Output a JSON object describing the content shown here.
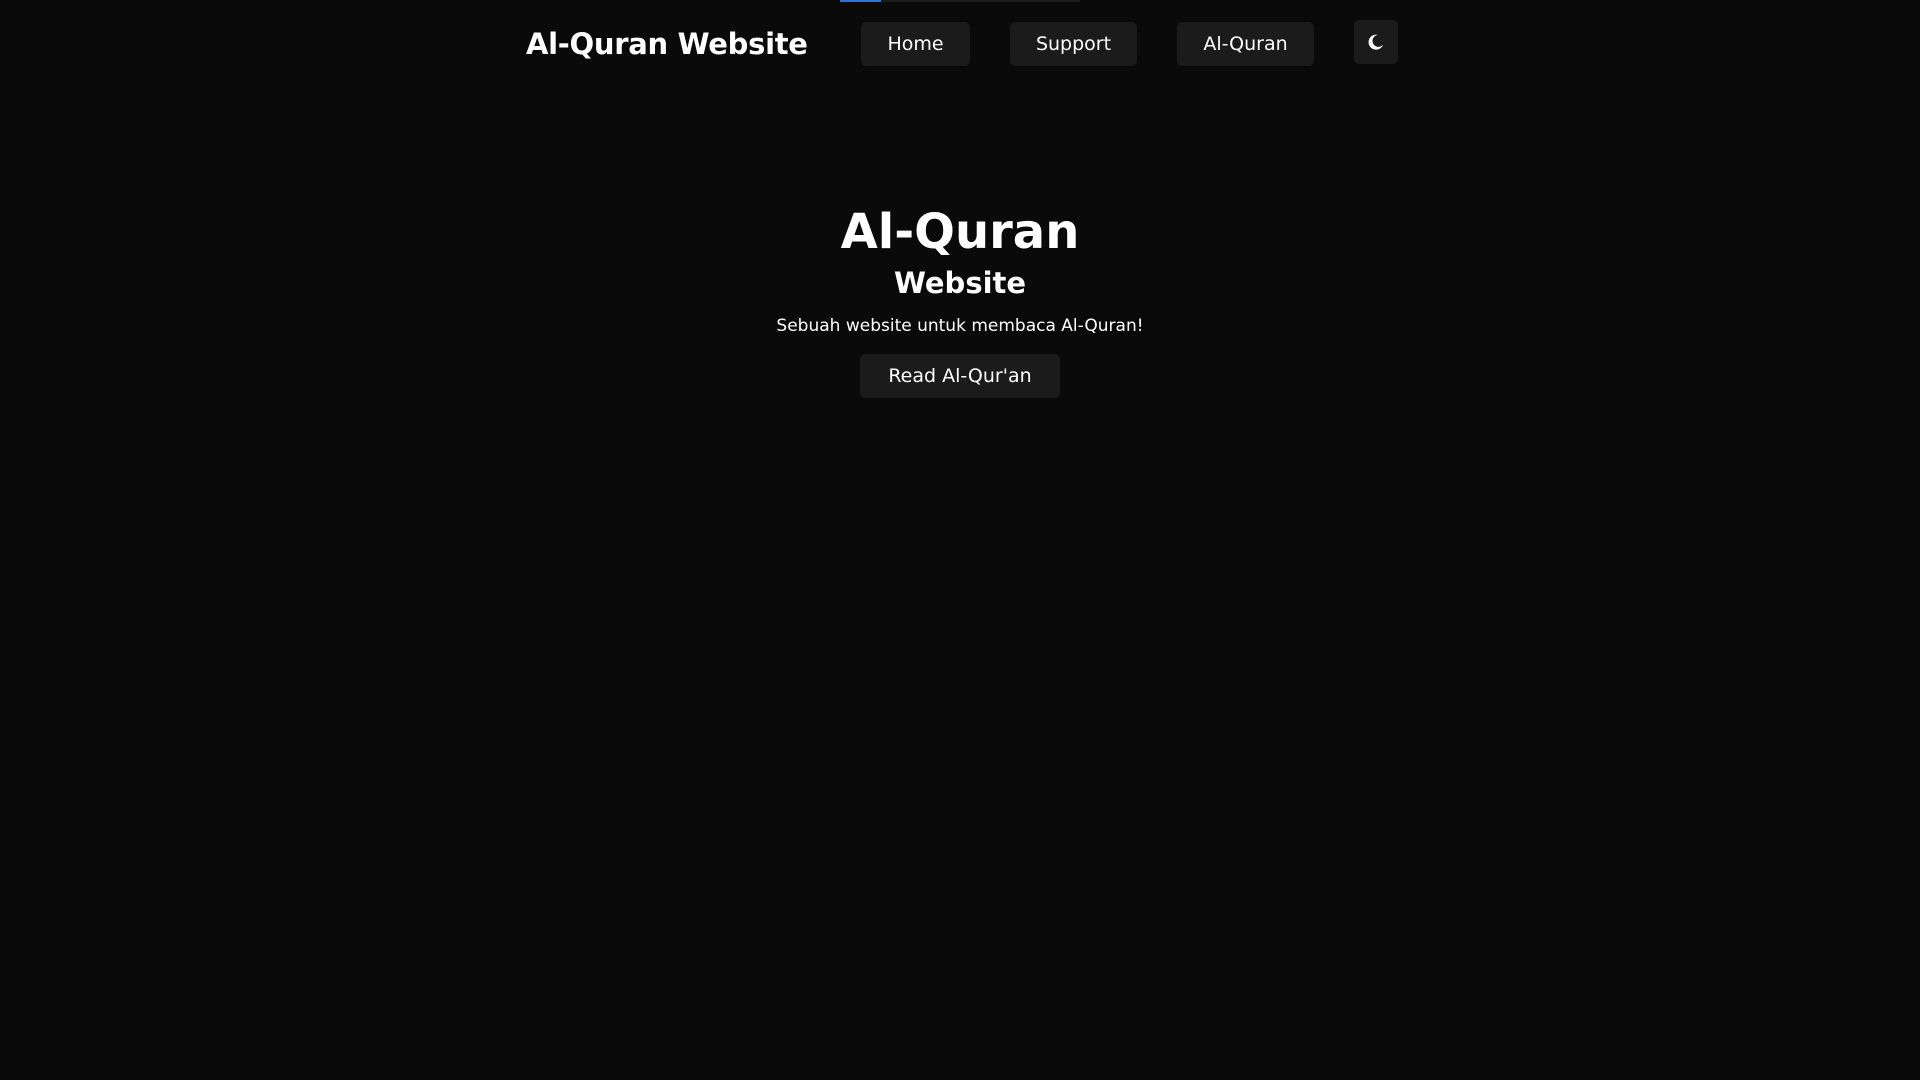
{
  "page_loader": {
    "progress_percent": 17
  },
  "navbar": {
    "brand": "Al-Quran Website",
    "links": [
      {
        "label": "Home"
      },
      {
        "label": "Support"
      },
      {
        "label": "Al-Quran"
      }
    ],
    "theme_toggle_icon": "moon-icon"
  },
  "hero": {
    "title": "Al-Quran",
    "subtitle": "Website",
    "description": "Sebuah website untuk membaca Al-Quran!",
    "button_label": "Read Al-Qur'an"
  },
  "colors": {
    "background": "#0a0a0a",
    "surface": "#1b1b1b",
    "text": "#ffffff",
    "accent": "#2b74d6"
  }
}
